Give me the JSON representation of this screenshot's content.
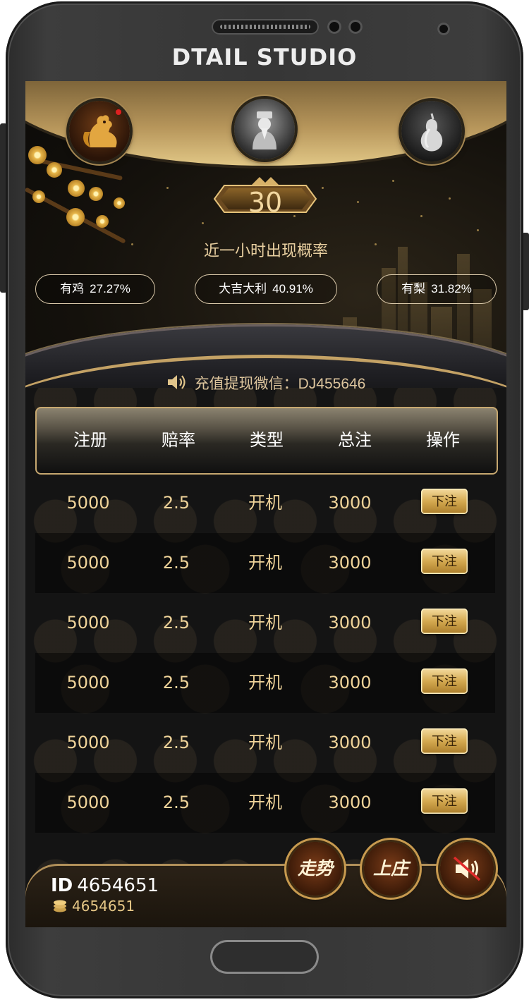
{
  "device": {
    "brand": "DTAIL STUDIO"
  },
  "round": {
    "count": "30"
  },
  "stats": {
    "title": "近一小时出现概率",
    "items": [
      {
        "label": "有鸡",
        "value": "27.27%"
      },
      {
        "label": "大吉大利",
        "value": "40.91%"
      },
      {
        "label": "有梨",
        "value": "31.82%"
      }
    ]
  },
  "notice": {
    "text": "充值提现微信：DJ455646"
  },
  "table": {
    "headers": [
      "注册",
      "赔率",
      "类型",
      "总注",
      "操作"
    ],
    "rows": [
      {
        "reg": "5000",
        "odds": "2.5",
        "type": "开机",
        "total": "3000",
        "action": "下注"
      },
      {
        "reg": "5000",
        "odds": "2.5",
        "type": "开机",
        "total": "3000",
        "action": "下注"
      },
      {
        "reg": "5000",
        "odds": "2.5",
        "type": "开机",
        "total": "3000",
        "action": "下注"
      },
      {
        "reg": "5000",
        "odds": "2.5",
        "type": "开机",
        "total": "3000",
        "action": "下注"
      },
      {
        "reg": "5000",
        "odds": "2.5",
        "type": "开机",
        "total": "3000",
        "action": "下注"
      },
      {
        "reg": "5000",
        "odds": "2.5",
        "type": "开机",
        "total": "3000",
        "action": "下注"
      }
    ]
  },
  "user": {
    "id_label": "ID",
    "id": "4654651",
    "coins": "4654651"
  },
  "actions": {
    "trend": "走势",
    "banker": "上庄",
    "sound_icon": "speaker-muted-icon"
  },
  "icons": {
    "avatars": [
      "rooster-icon",
      "fortune-god-icon",
      "pear-icon"
    ]
  },
  "colors": {
    "gold": "#c7a870",
    "accent_text": "#f0d49a"
  }
}
